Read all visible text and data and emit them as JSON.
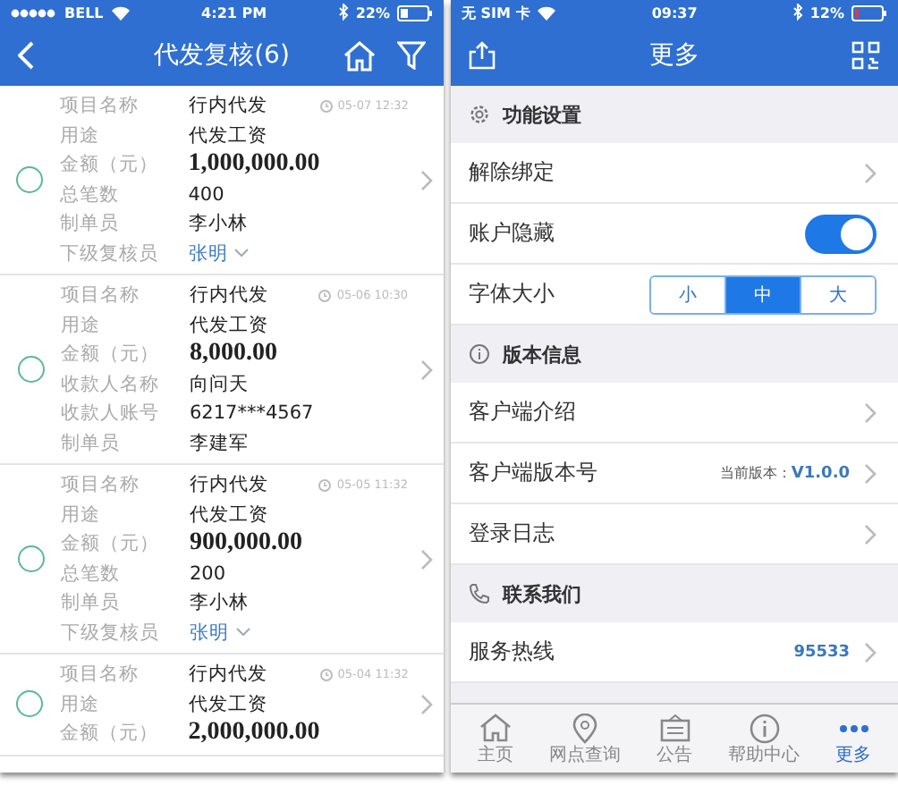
{
  "left_screen": {
    "status_bar": {
      "carrier": "BELL",
      "time": "4:21 PM",
      "battery": "22%"
    },
    "title": "代发复核(6)",
    "items": [
      {
        "selected": false,
        "timestamp": "05-07 12:32",
        "fields": [
          {
            "label": "项目名称",
            "value": "行内代发",
            "kind": "text"
          },
          {
            "label": "用途",
            "value": "代发工资",
            "kind": "text"
          },
          {
            "label": "金额（元）",
            "value": "1,000,000.00",
            "kind": "amount"
          },
          {
            "label": "总笔数",
            "value": "400",
            "kind": "text"
          },
          {
            "label": "制单员",
            "value": "李小林",
            "kind": "text"
          },
          {
            "label": "下级复核员",
            "value": "张明",
            "kind": "dropdown"
          }
        ]
      },
      {
        "selected": false,
        "timestamp": "05-06 10:30",
        "fields": [
          {
            "label": "项目名称",
            "value": "行内代发",
            "kind": "text"
          },
          {
            "label": "用途",
            "value": "代发工资",
            "kind": "text"
          },
          {
            "label": "金额（元）",
            "value": "8,000.00",
            "kind": "amount"
          },
          {
            "label": "收款人名称",
            "value": "向问天",
            "kind": "text"
          },
          {
            "label": "收款人账号",
            "value": "6217***4567",
            "kind": "text"
          },
          {
            "label": "制单员",
            "value": "李建军",
            "kind": "text"
          }
        ]
      },
      {
        "selected": false,
        "timestamp": "05-05 11:32",
        "fields": [
          {
            "label": "项目名称",
            "value": "行内代发",
            "kind": "text"
          },
          {
            "label": "用途",
            "value": "代发工资",
            "kind": "text"
          },
          {
            "label": "金额（元）",
            "value": "900,000.00",
            "kind": "amount"
          },
          {
            "label": "总笔数",
            "value": "200",
            "kind": "text"
          },
          {
            "label": "制单员",
            "value": "李小林",
            "kind": "text"
          },
          {
            "label": "下级复核员",
            "value": "张明",
            "kind": "dropdown"
          }
        ]
      },
      {
        "selected": false,
        "timestamp": "05-04 11:32",
        "fields": [
          {
            "label": "项目名称",
            "value": "行内代发",
            "kind": "text"
          },
          {
            "label": "用途",
            "value": "代发工资",
            "kind": "text"
          },
          {
            "label": "金额（元）",
            "value": "2,000,000.00",
            "kind": "amount"
          }
        ]
      }
    ]
  },
  "right_screen": {
    "status_bar": {
      "carrier": "无 SIM 卡",
      "time": "09:37",
      "battery": "12%"
    },
    "title": "更多",
    "sections": [
      {
        "title": "功能设置",
        "rows": [
          {
            "kind": "link",
            "label": "解除绑定"
          },
          {
            "kind": "toggle",
            "label": "账户隐藏",
            "on": true
          },
          {
            "kind": "segmented",
            "label": "字体大小",
            "options": [
              {
                "label": "小",
                "selected": false
              },
              {
                "label": "中",
                "selected": true
              },
              {
                "label": "大",
                "selected": false
              }
            ]
          }
        ]
      },
      {
        "title": "版本信息",
        "rows": [
          {
            "kind": "link",
            "label": "客户端介绍"
          },
          {
            "kind": "link",
            "label": "客户端版本号",
            "note": "当前版本：",
            "value": "V1.0.0"
          },
          {
            "kind": "link",
            "label": "登录日志"
          }
        ]
      },
      {
        "title": "联系我们",
        "rows": [
          {
            "kind": "link",
            "label": "服务热线",
            "value": "95533"
          }
        ]
      }
    ],
    "tab_bar": [
      {
        "label": "主页",
        "selected": false
      },
      {
        "label": "网点查询",
        "selected": false
      },
      {
        "label": "公告",
        "selected": false
      },
      {
        "label": "帮助中心",
        "selected": false
      },
      {
        "label": "更多",
        "selected": true
      }
    ]
  }
}
